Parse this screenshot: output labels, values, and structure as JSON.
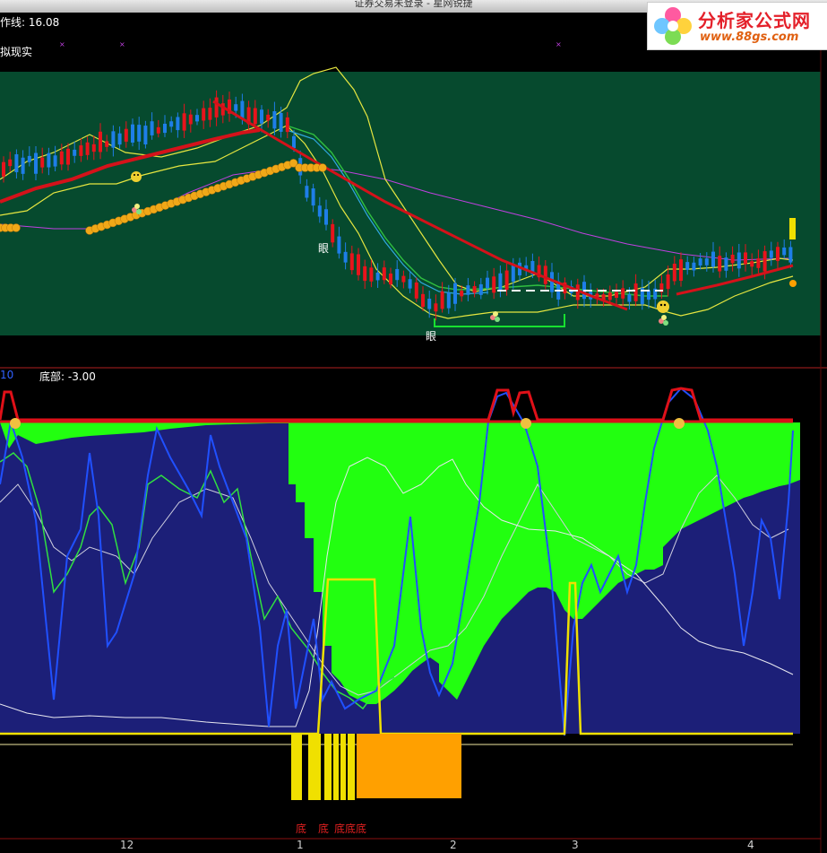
{
  "window": {
    "title": "证券交易未登录 - 星网锐捷"
  },
  "top_panel": {
    "indicator_label": "作线: 16.08",
    "side_label": "拟现实",
    "eye_label_1": "眼",
    "eye_label_2": "眼"
  },
  "lower_panel": {
    "axis_label": "10",
    "indicator_label": "底部: -3.00"
  },
  "bottom_markers": [
    "底",
    "底",
    "底底底"
  ],
  "time_axis": [
    "12",
    "1",
    "2",
    "3",
    "4"
  ],
  "logo": {
    "name": "分析家公式网",
    "url": "www.88gs.com"
  },
  "colors": {
    "top_bg": "#064a2e",
    "lower_bg": "#1c1f78",
    "green_fill": "#22ff10",
    "red_line": "#d4121a",
    "yellow": "#f0e000",
    "orange_block": "#ffa000",
    "bull_candle": "#e8141c",
    "bear_candle": "#1e7ee8"
  }
}
